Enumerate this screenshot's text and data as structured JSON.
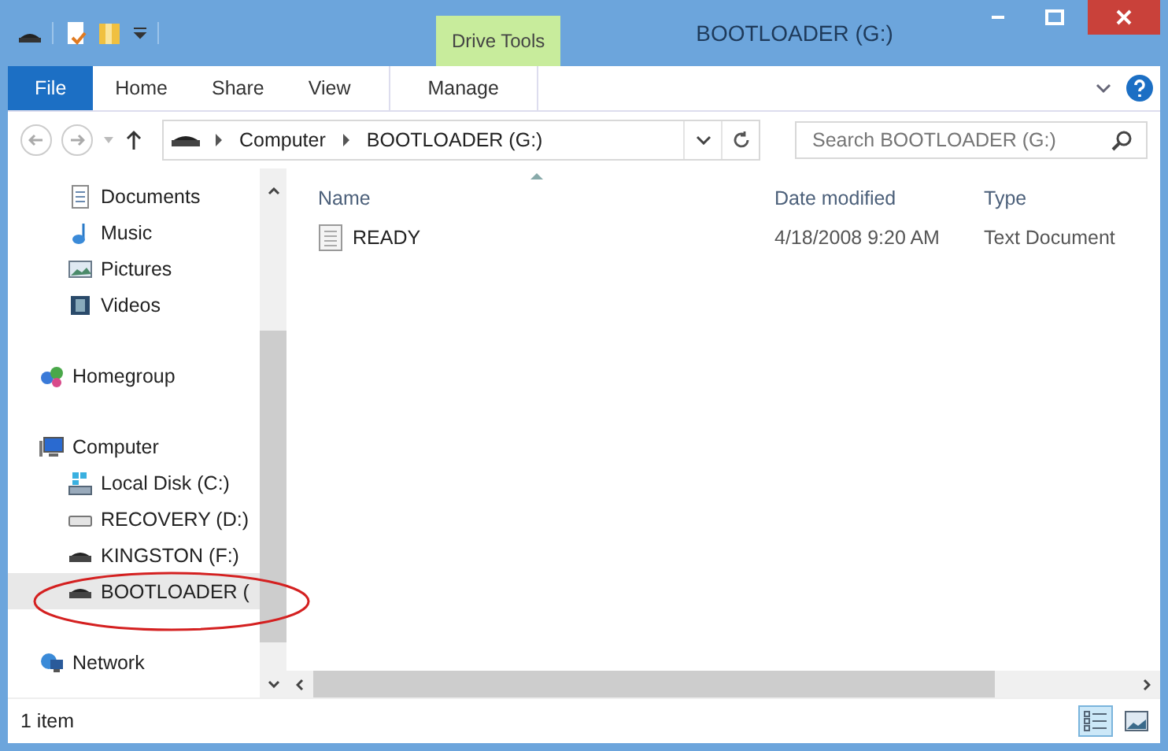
{
  "window": {
    "title": "BOOTLOADER (G:)",
    "context_group": "Drive Tools"
  },
  "ribbon_tabs": [
    {
      "label": "File",
      "kind": "file"
    },
    {
      "label": "Home",
      "kind": "normal"
    },
    {
      "label": "Share",
      "kind": "normal"
    },
    {
      "label": "View",
      "kind": "normal"
    },
    {
      "label": "Manage",
      "kind": "contextual"
    }
  ],
  "address": {
    "segments": [
      "Computer",
      "BOOTLOADER (G:)"
    ]
  },
  "search": {
    "placeholder": "Search BOOTLOADER (G:)"
  },
  "sidebar": {
    "sections": [
      {
        "items": [
          {
            "label": "Documents",
            "kind": "document",
            "selected": false
          },
          {
            "label": "Music",
            "kind": "music",
            "selected": false
          },
          {
            "label": "Pictures",
            "kind": "pictures",
            "selected": false
          },
          {
            "label": "Videos",
            "kind": "video",
            "selected": false
          }
        ]
      },
      {
        "items": [
          {
            "label": "Homegroup",
            "kind": "homegroup",
            "selected": false
          }
        ]
      },
      {
        "items": [
          {
            "label": "Computer",
            "kind": "computer",
            "selected": false,
            "children": [
              {
                "label": "Local Disk (C:)",
                "kind": "system",
                "selected": false
              },
              {
                "label": "RECOVERY (D:)",
                "kind": "drive",
                "selected": false
              },
              {
                "label": "KINGSTON (F:)",
                "kind": "usb",
                "selected": false
              },
              {
                "label": "BOOTLOADER (",
                "kind": "usb",
                "selected": true
              }
            ]
          }
        ]
      },
      {
        "items": [
          {
            "label": "Network",
            "kind": "network",
            "selected": false
          }
        ]
      }
    ]
  },
  "table": {
    "columns": [
      {
        "label": "Name",
        "sorted": true
      },
      {
        "label": "Date modified",
        "sorted": false
      },
      {
        "label": "Type",
        "sorted": false
      }
    ],
    "rows": [
      {
        "name": "READY",
        "date": "4/18/2008 9:20 AM",
        "type": "Text Document"
      }
    ]
  },
  "status_bar": {
    "text": "1 item",
    "views": [
      {
        "kind": "details",
        "selected": true
      },
      {
        "kind": "large-icons",
        "selected": false
      }
    ]
  },
  "annotation": {
    "kind": "ellipse"
  }
}
